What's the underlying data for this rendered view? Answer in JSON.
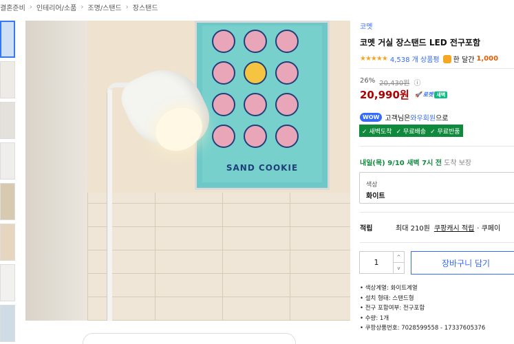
{
  "breadcrumb": [
    "결혼준비",
    "인테리어/소품",
    "조명/스탠드",
    "장스탠드"
  ],
  "product": {
    "brand": "코멧",
    "title": "코멧 거실 장스탠드 LED 전구포함",
    "stars": "★★★★★",
    "review_count": "4,538 개 상품평",
    "month_label": "한 달간",
    "month_count": "1,000",
    "discount_rate": "26%",
    "original_price": "20,430원",
    "info_icon": "ⓘ",
    "sale_price": "20,990원",
    "rocket_label": "로켓",
    "rocket_sub": "새벽",
    "wow_badge": "WOW",
    "wow_prefix": "고객님은",
    "wow_link": "와우회원",
    "wow_suffix": "으로",
    "benefits": [
      "✓ 새벽도착",
      "✓ 무료배송",
      "✓ 무료반품"
    ],
    "delivery_date": "내일(목) 9/10 새벽 7시 전",
    "delivery_suffix": "도착 보장",
    "option_label": "색상",
    "option_value": "화이트",
    "reward_head": "적립",
    "reward_text": "최대 210원",
    "reward_link": "쿠팡캐시 적립",
    "reward_extra": "· 쿠페이",
    "quantity": "1",
    "qty_up": "^",
    "qty_down": "v",
    "cart_button": "장바구니 담기",
    "specs": [
      "색상계열: 화이트계열",
      "설치 형태: 스탠드형",
      "전구 포함여부: 전구포함",
      "수량: 1개",
      "쿠팡상품번호: 7028599558 - 17337605376"
    ]
  },
  "poster": {
    "title": "SAND COOKIE"
  },
  "colors": {
    "accent": "#346aff",
    "price": "#ae0000",
    "benefit_bg": "#0f8a3c"
  },
  "icons": {
    "thumb_colors": [
      "#cfe0f4",
      "#eeeae6",
      "#e4e0dc",
      "#f0eeec",
      "#d8c9b1",
      "#e6d6bf",
      "#f2f1ef",
      "#cfdce6"
    ]
  }
}
